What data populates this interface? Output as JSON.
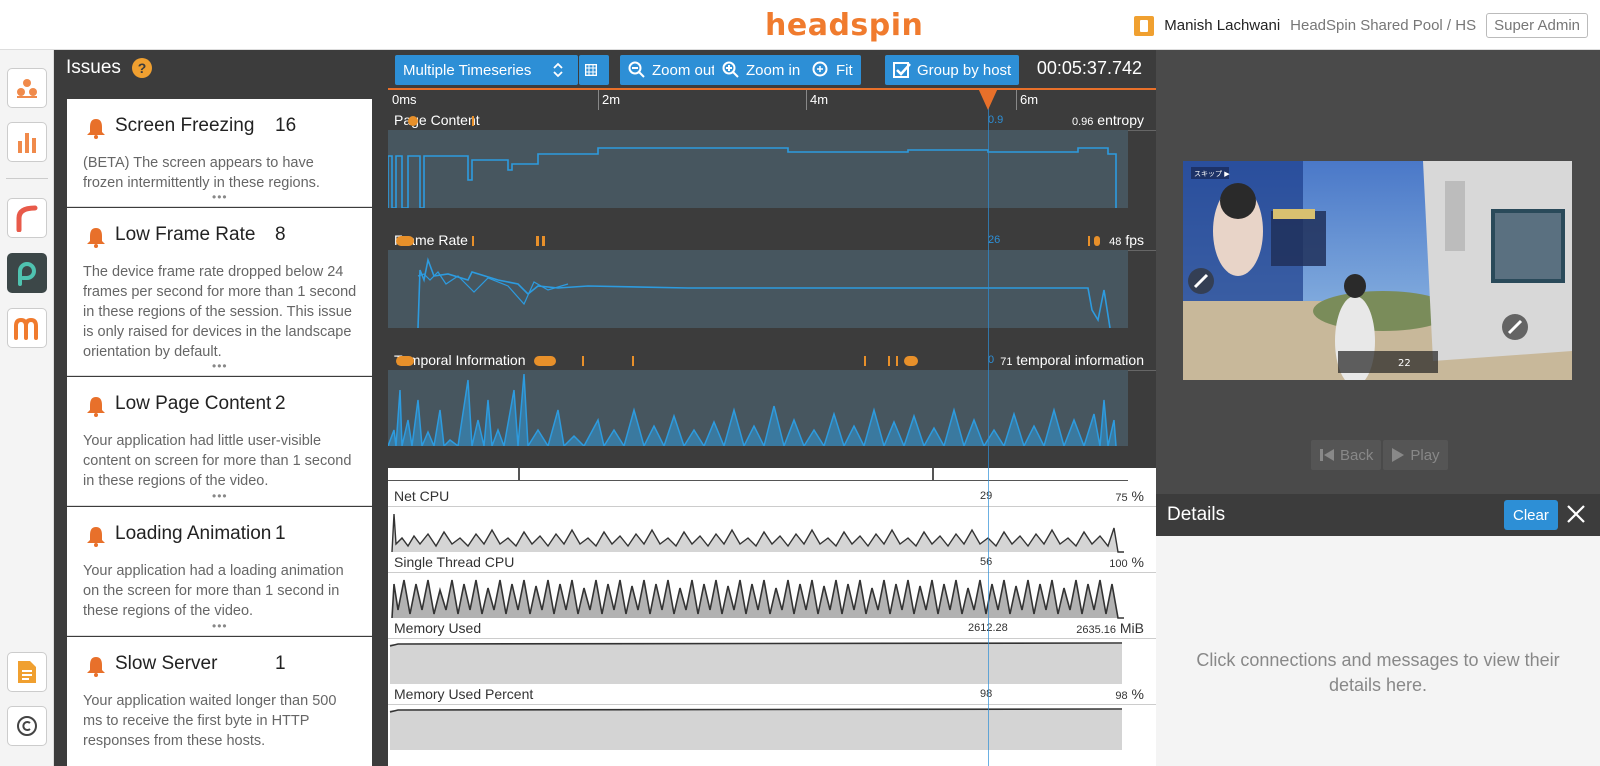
{
  "app": {
    "logo": "headspin"
  },
  "user": {
    "name": "Manish Lachwani",
    "pool": "HeadSpin Shared Pool / HS",
    "role": "Super Admin"
  },
  "leftnav": {
    "items": [
      "apps-icon",
      "analytics-icon",
      "waterfall-icon",
      "performance-icon",
      "m-icon",
      "notes-icon",
      "copyright-icon"
    ]
  },
  "issues": {
    "title": "Issues",
    "help": "?",
    "items": [
      {
        "title": "Screen Freezing",
        "count": "16",
        "desc": "(BETA) The screen appears to have frozen intermittently in these regions."
      },
      {
        "title": "Low Frame Rate",
        "count": "8",
        "desc": "The device frame rate dropped below 24 frames per second for more than 1 second in these regions of the session. This issue is only raised for devices in the landscape orientation by default."
      },
      {
        "title": "Low Page Content",
        "count": "2",
        "desc": "Your application had little user-visible content on screen for more than 1 second in these regions of the video."
      },
      {
        "title": "Loading Animation",
        "count": "1",
        "desc": "Your application had a loading animation on the screen for more than 1 second in these regions of the video."
      },
      {
        "title": "Slow Server",
        "count": "1",
        "desc": "Your application waited longer than 500 ms to receive the first byte in HTTP responses from these hosts."
      }
    ],
    "more": "•••"
  },
  "toolbar": {
    "select_label": "Multiple Timeseries",
    "zoom_out": "Zoom out",
    "zoom_in": "Zoom in",
    "fit": "Fit",
    "group_by_host": "Group by host",
    "time": "00:05:37.742"
  },
  "ruler": {
    "ticks": [
      "0ms",
      "2m",
      "4m",
      "6m"
    ]
  },
  "tracks": [
    {
      "label": "Page Content",
      "cursor_value": "0.9",
      "max_value": "0.96",
      "unit": "entropy"
    },
    {
      "label": "Frame Rate",
      "cursor_value": "26",
      "max_value": "48",
      "unit": "fps"
    },
    {
      "label": "Temporal Information",
      "cursor_value": "0",
      "max_value": "71",
      "unit": "temporal information"
    }
  ],
  "cpu_tracks": [
    {
      "label": "Net CPU",
      "cursor_value": "29",
      "max_value": "75",
      "unit": "%"
    },
    {
      "label": "Single Thread CPU",
      "cursor_value": "56",
      "max_value": "100",
      "unit": "%"
    },
    {
      "label": "Memory Used",
      "cursor_value": "2612.28",
      "max_value": "2635.16",
      "unit": "MiB"
    },
    {
      "label": "Memory Used Percent",
      "cursor_value": "98",
      "max_value": "98",
      "unit": "%"
    }
  ],
  "video": {
    "skip_label": "スキップ ▶",
    "ammo": "22"
  },
  "playback": {
    "back": "Back",
    "play": "Play"
  },
  "details": {
    "title": "Details",
    "clear": "Clear",
    "message": "Click connections and messages to view their details here."
  },
  "colors": {
    "accent": "#f07b2e",
    "blue": "#2d8fd6",
    "dark": "#3c3c3c"
  }
}
